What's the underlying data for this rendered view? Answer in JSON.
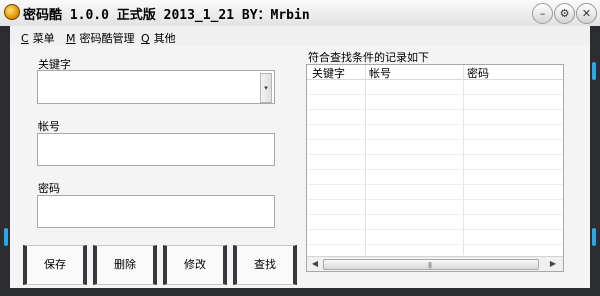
{
  "window": {
    "title": "密码酷 1.0.0 正式版 2013_1_21  BY：Mrbin",
    "minimize_glyph": "–",
    "settings_glyph": "⚙",
    "close_glyph": "✕"
  },
  "menu": [
    {
      "accel": "C",
      "label": "菜单"
    },
    {
      "accel": "M",
      "label": "密码酷管理"
    },
    {
      "accel": "Q",
      "label": "其他"
    }
  ],
  "form": {
    "keyword_label": "关键字",
    "keyword_value": "",
    "account_label": "帐号",
    "account_value": "",
    "password_label": "密码",
    "password_value": ""
  },
  "results": {
    "caption": "符合查找条件的记录如下",
    "columns": [
      "关键字",
      "帐号",
      "密码"
    ],
    "rows": []
  },
  "buttons": {
    "save": "保存",
    "delete": "删除",
    "modify": "修改",
    "search": "查找"
  },
  "colors": {
    "frame": "#2b2d30",
    "accent": "#2aa8e8"
  }
}
